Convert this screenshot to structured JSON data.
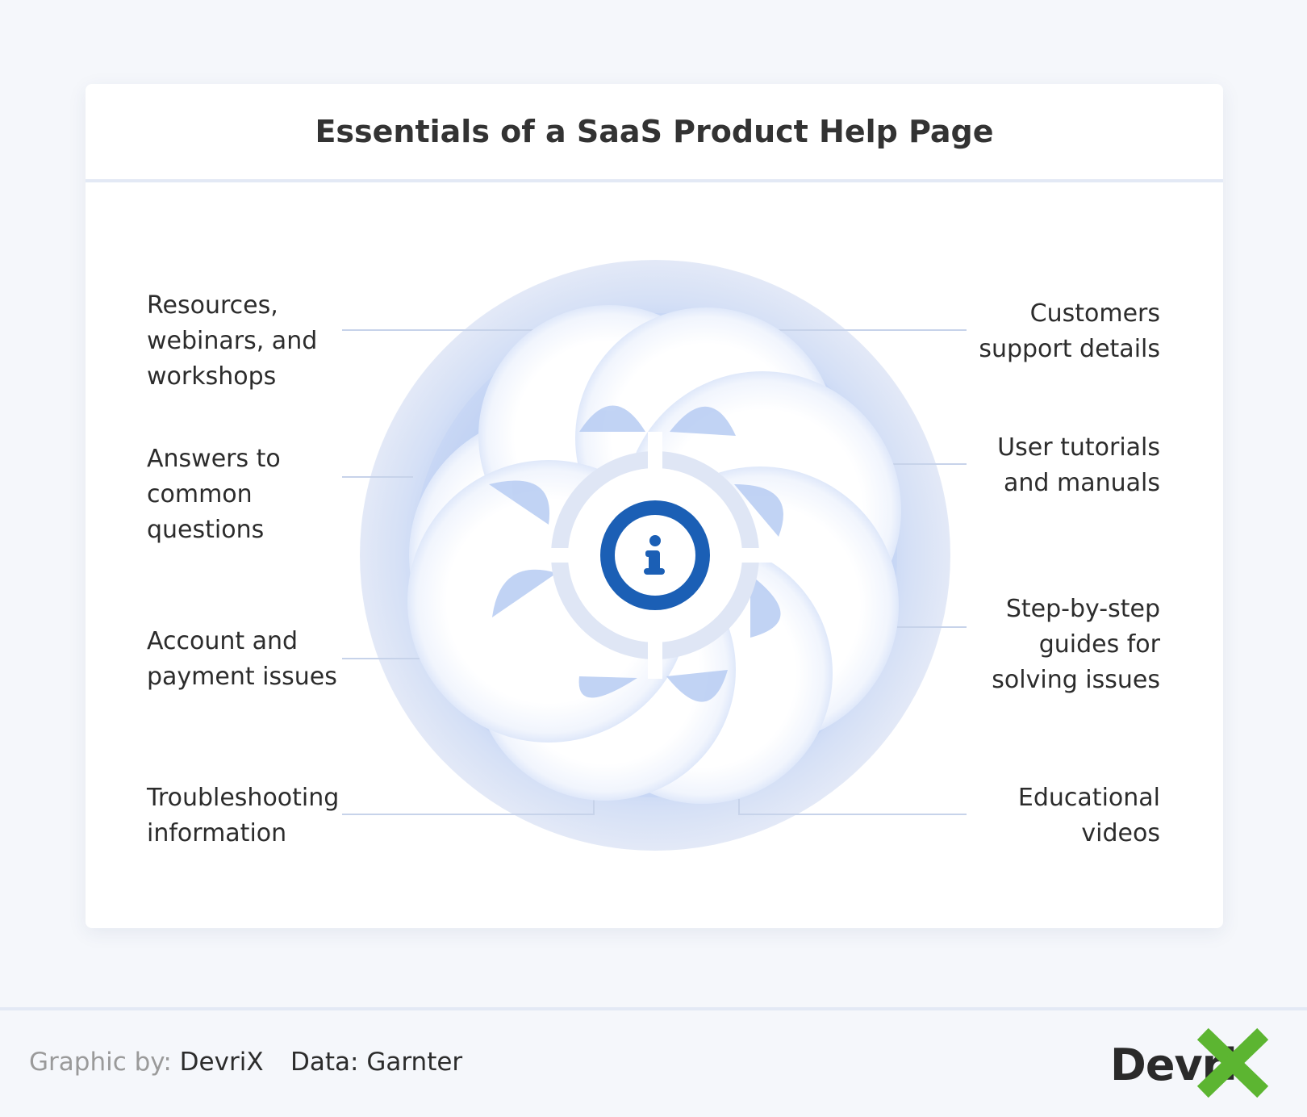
{
  "title": "Essentials of a SaaS Product Help Page",
  "center_icon": "info-icon",
  "labels": {
    "left": [
      "Resources,\nwebinars, and\nworkshops",
      "Answers to\ncommon\nquestions",
      "Account and\npayment issues",
      "Troubleshooting\ninformation"
    ],
    "right": [
      "Customers\nsupport details",
      "User tutorials\nand manuals",
      "Step-by-step\nguides for\nsolving issues",
      "Educational\nvideos"
    ]
  },
  "footer": {
    "graphic_by_label": "Graphic by:",
    "graphic_by_value": "DevriX",
    "data_label": "Data:",
    "data_value": "Garnter"
  },
  "logo": {
    "text": "Devri",
    "mark": "X",
    "mark_color": "#5cb531"
  },
  "colors": {
    "accent_blue": "#1b5fb5",
    "ring": "#dfe6f6",
    "petal_shadow": "#a9c2ef",
    "connector": "#c7d3ea"
  }
}
